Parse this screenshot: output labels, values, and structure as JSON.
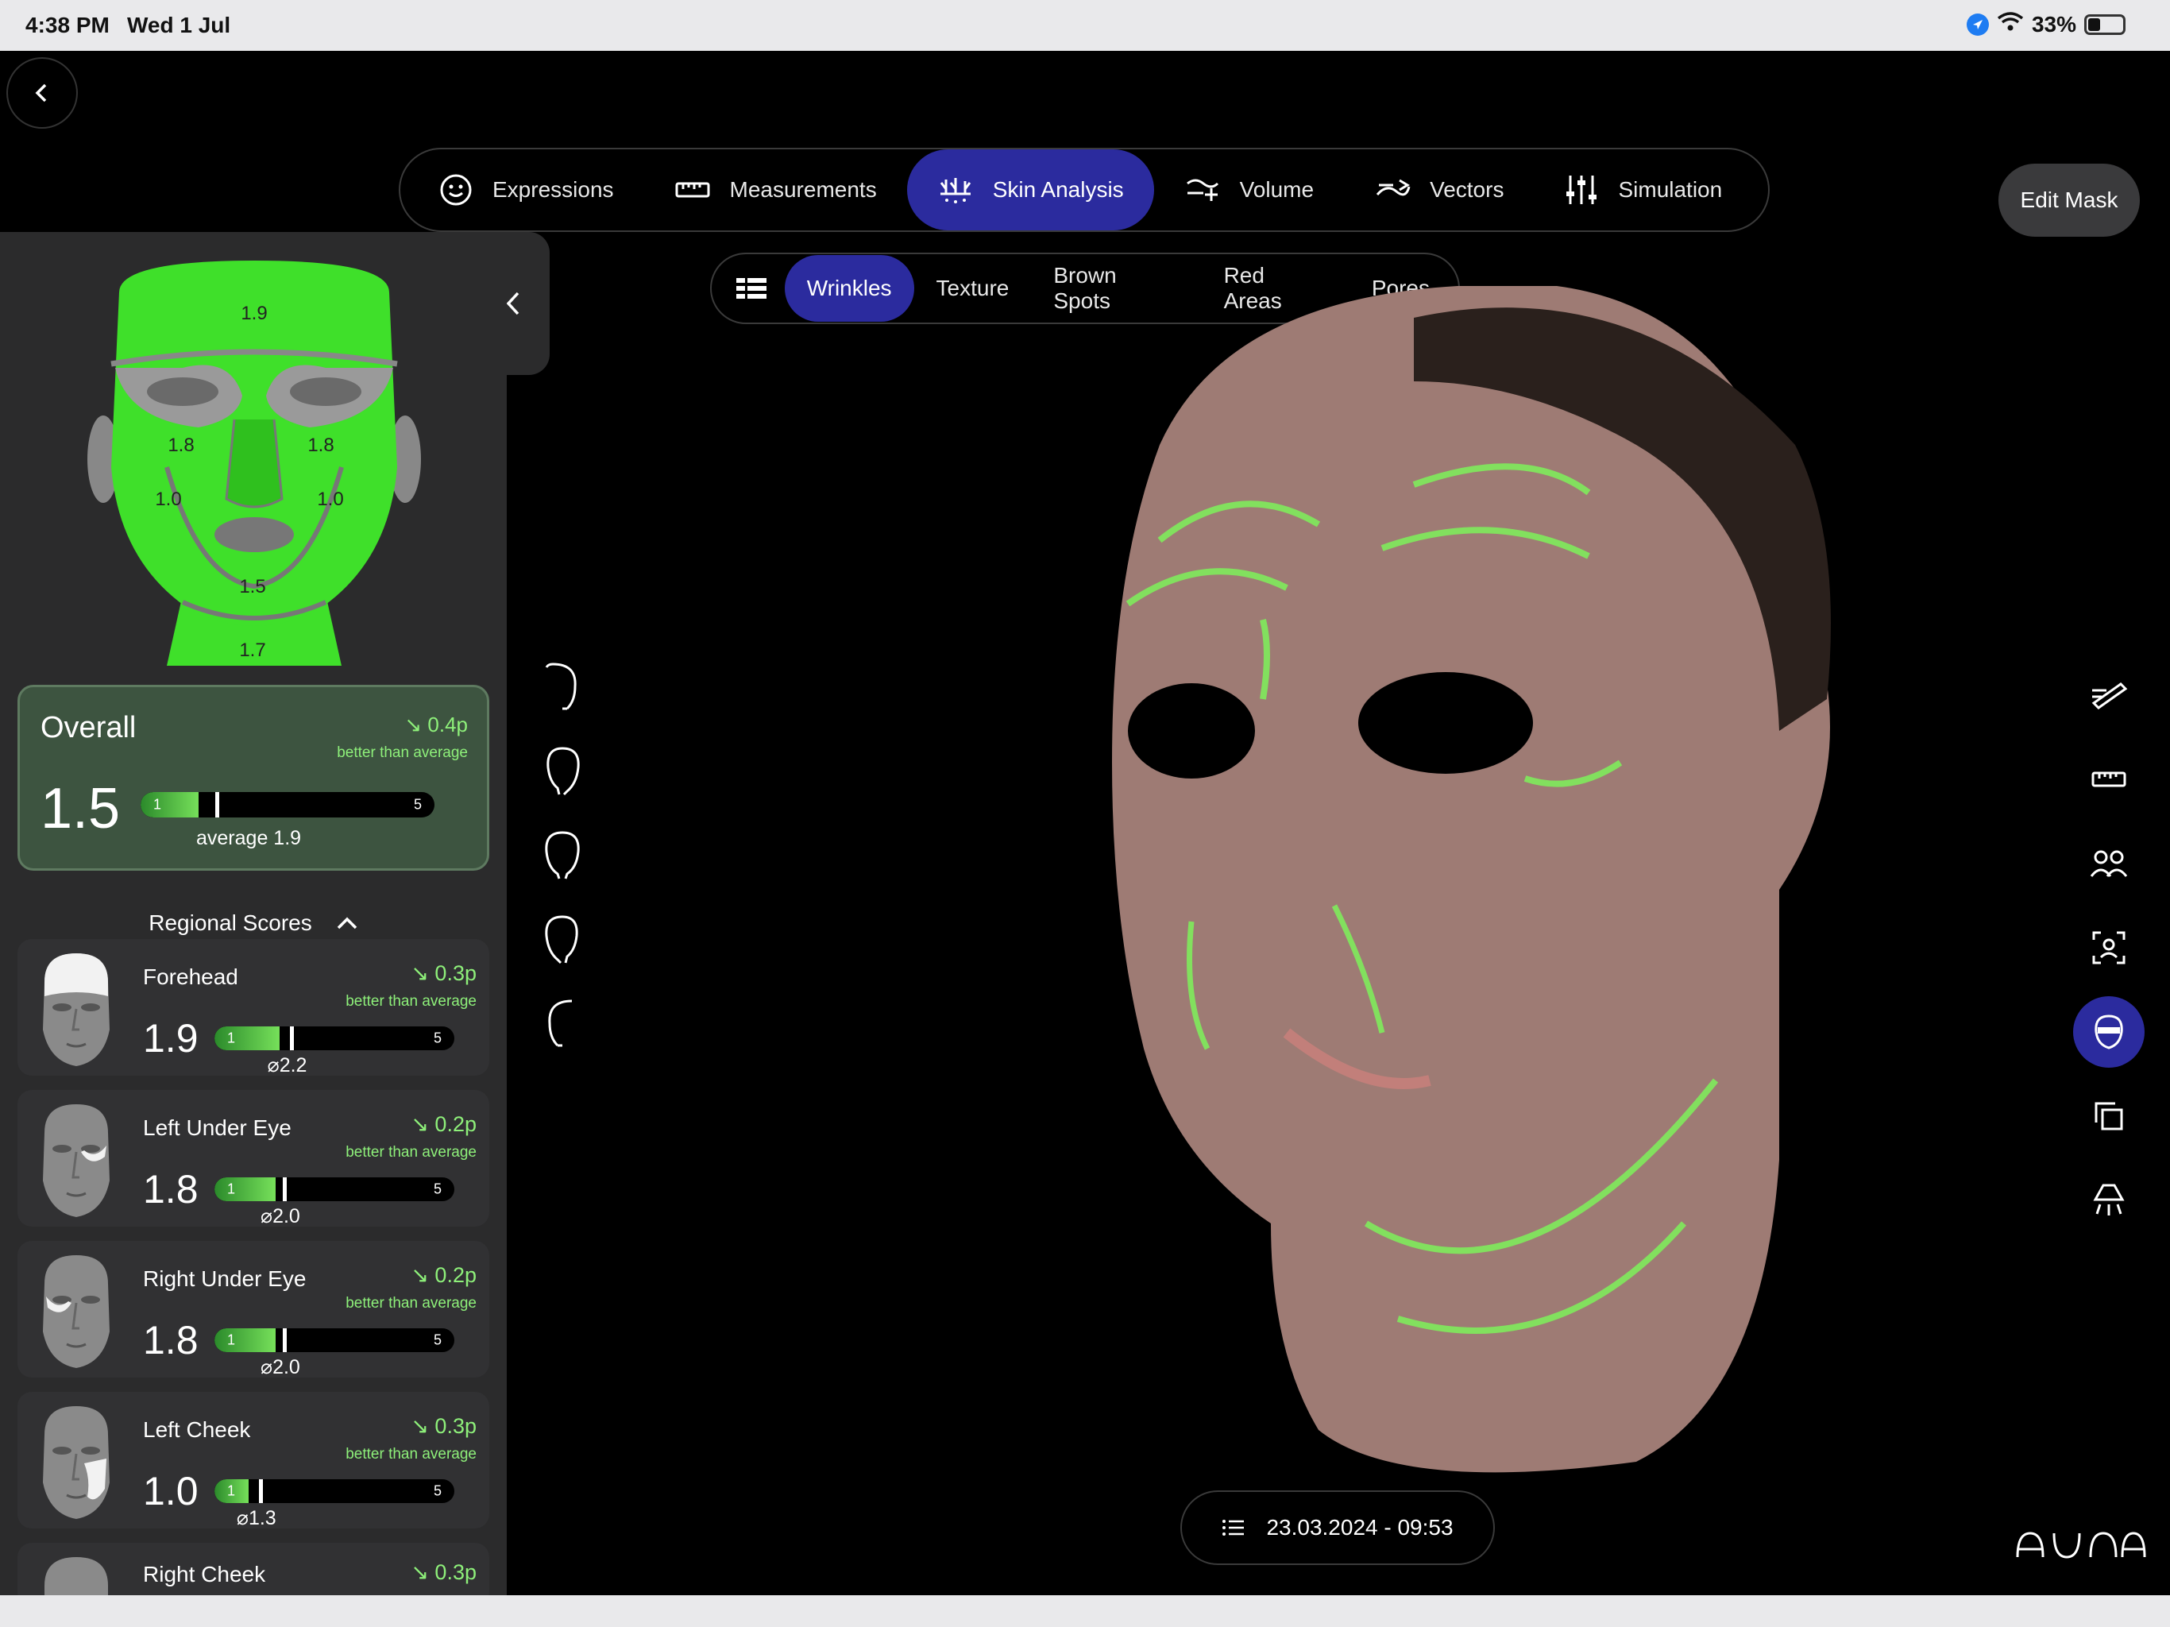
{
  "status_bar": {
    "time": "4:38 PM",
    "date": "Wed 1 Jul",
    "battery": "33%",
    "battery_level": 0.33
  },
  "top_nav": {
    "items": [
      {
        "label": "Expressions",
        "icon": "smiley-icon"
      },
      {
        "label": "Measurements",
        "icon": "ruler-icon"
      },
      {
        "label": "Skin Analysis",
        "icon": "skin-analysis-icon",
        "active": true
      },
      {
        "label": "Volume",
        "icon": "volume-icon"
      },
      {
        "label": "Vectors",
        "icon": "vectors-icon"
      },
      {
        "label": "Simulation",
        "icon": "sliders-icon"
      }
    ]
  },
  "edit_mask_label": "Edit Mask",
  "sub_nav": {
    "tabs": [
      {
        "label": "Wrinkles",
        "active": true
      },
      {
        "label": "Texture"
      },
      {
        "label": "Brown Spots"
      },
      {
        "label": "Red Areas"
      },
      {
        "label": "Pores"
      }
    ]
  },
  "face_map": {
    "forehead": "1.9",
    "left_under_eye": "1.8",
    "right_under_eye": "1.8",
    "left_cheek": "1.0",
    "right_cheek": "1.0",
    "chin": "1.5",
    "neck": "1.7"
  },
  "overall": {
    "title": "Overall",
    "delta": "↘ 0.4p",
    "delta_sub": "better than average",
    "score": "1.5",
    "scale_min": "1",
    "scale_max": "5",
    "score_value": 1.5,
    "average_value": 1.9,
    "average_label": "average 1.9"
  },
  "regional": {
    "title": "Regional Scores",
    "items": [
      {
        "name": "Forehead",
        "delta": "↘ 0.3p",
        "delta_sub": "better than average",
        "score": "1.9",
        "score_value": 1.9,
        "avg": "⌀2.2",
        "avg_value": 2.2,
        "min": "1",
        "max": "5"
      },
      {
        "name": "Left Under Eye",
        "delta": "↘ 0.2p",
        "delta_sub": "better than average",
        "score": "1.8",
        "score_value": 1.8,
        "avg": "⌀2.0",
        "avg_value": 2.0,
        "min": "1",
        "max": "5"
      },
      {
        "name": "Right Under Eye",
        "delta": "↘ 0.2p",
        "delta_sub": "better than average",
        "score": "1.8",
        "score_value": 1.8,
        "avg": "⌀2.0",
        "avg_value": 2.0,
        "min": "1",
        "max": "5"
      },
      {
        "name": "Left Cheek",
        "delta": "↘ 0.3p",
        "delta_sub": "better than average",
        "score": "1.0",
        "score_value": 1.0,
        "avg": "⌀1.3",
        "avg_value": 1.3,
        "min": "1",
        "max": "5"
      },
      {
        "name": "Right Cheek",
        "delta": "↘ 0.3p"
      }
    ]
  },
  "view_buttons": [
    "profile-left-icon",
    "three-quarter-left-icon",
    "front-view-icon",
    "three-quarter-right-icon",
    "profile-right-icon"
  ],
  "right_tools": [
    "annotate-icon",
    "ruler-icon",
    "compare-icon",
    "face-scan-icon",
    "mask-icon",
    "duplicate-icon",
    "lighting-icon"
  ],
  "session_date": "23.03.2024 - 09:53",
  "colors": {
    "accent": "#2b2b9e",
    "positive": "#8ef07a",
    "map_green": "#3fe02a"
  }
}
